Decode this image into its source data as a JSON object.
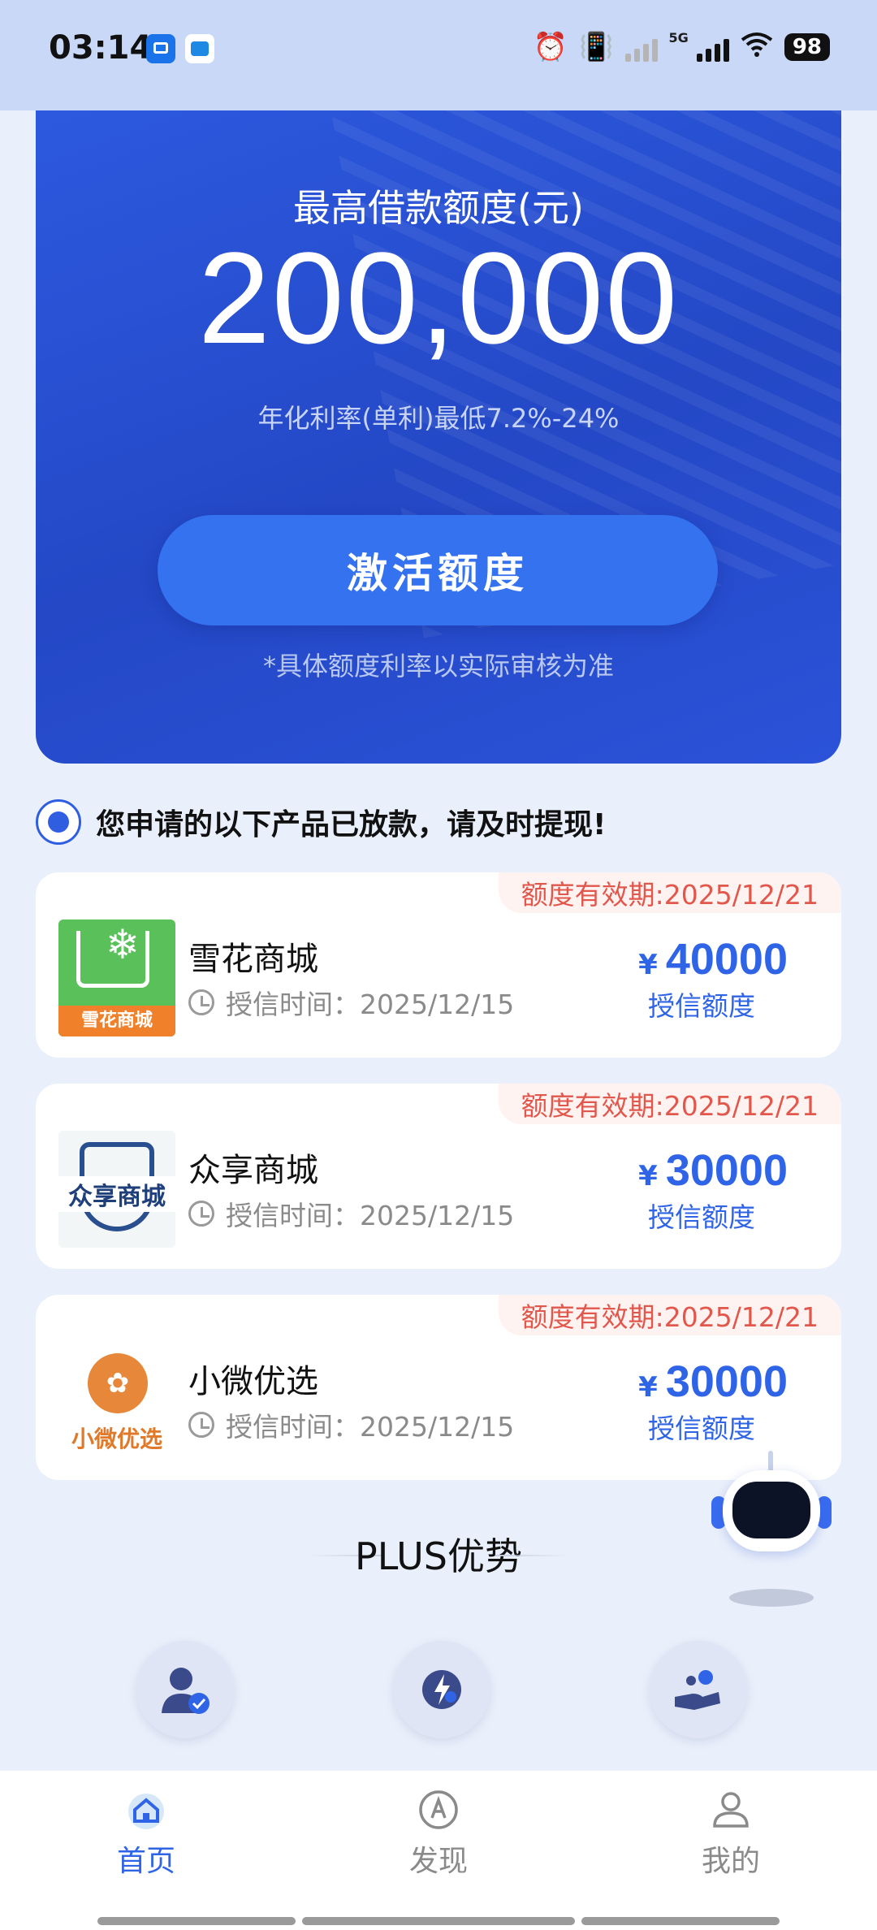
{
  "status_bar": {
    "time": "03:14",
    "network": "5G",
    "battery": "98"
  },
  "hero": {
    "title": "最高借款额度(元)",
    "amount": "200,000",
    "rate": "年化利率(单利)最低7.2%-24%",
    "button": "激活额度",
    "note": "*具体额度利率以实际审核为准"
  },
  "notice": {
    "text": "您申请的以下产品已放款，请及时提现!"
  },
  "products": [
    {
      "validity": "额度有效期:2025/12/21",
      "name": "雪花商城",
      "logo_text": "雪花商城",
      "time": "授信时间：2025/12/15",
      "currency": "¥",
      "amount": "40000",
      "amount_label": "授信额度"
    },
    {
      "validity": "额度有效期:2025/12/21",
      "name": "众享商城",
      "logo_text": "众享商城",
      "time": "授信时间：2025/12/15",
      "currency": "¥",
      "amount": "30000",
      "amount_label": "授信额度"
    },
    {
      "validity": "额度有效期:2025/12/21",
      "name": "小微优选",
      "logo_text": "小微优选",
      "time": "授信时间：2025/12/15",
      "currency": "¥",
      "amount": "30000",
      "amount_label": "授信额度"
    }
  ],
  "plus": {
    "title": "PLUS优势",
    "icons": [
      "verified-user-icon",
      "fast-loan-icon",
      "hand-coins-icon"
    ]
  },
  "tabbar": {
    "items": [
      {
        "label": "首页",
        "icon": "home-icon",
        "active": true
      },
      {
        "label": "发现",
        "icon": "compass-icon",
        "active": false
      },
      {
        "label": "我的",
        "icon": "profile-icon",
        "active": false
      }
    ]
  },
  "colors": {
    "accent": "#2f64e6",
    "hero_bg": "#2448c6",
    "validity_red": "#e2574c"
  }
}
